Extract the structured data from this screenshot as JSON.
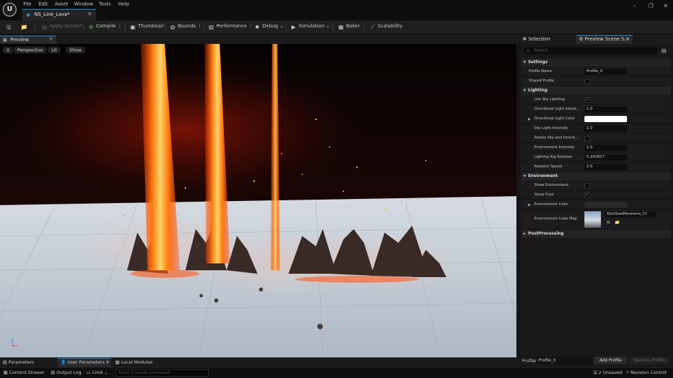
{
  "app": {
    "logo": "U",
    "menu": [
      "File",
      "Edit",
      "Asset",
      "Window",
      "Tools",
      "Help"
    ],
    "tab_title": "NS_Line_Lava*",
    "window_controls": [
      "–",
      "❐",
      "✕"
    ]
  },
  "toolbar": {
    "items": [
      {
        "label": "Apply Scratch",
        "icon": "apply-icon",
        "enabled": false
      },
      {
        "label": "Compile",
        "icon": "compile-icon",
        "enabled": true
      },
      {
        "label": "Thumbnail",
        "icon": "thumbnail-icon",
        "enabled": true
      },
      {
        "label": "Bounds",
        "icon": "bounds-icon",
        "enabled": true
      },
      {
        "label": "Performance",
        "icon": "performance-icon",
        "enabled": true
      },
      {
        "label": "Debug",
        "icon": "debug-icon",
        "enabled": true
      },
      {
        "label": "Simulation",
        "icon": "simulation-icon",
        "enabled": true
      },
      {
        "label": "Baker",
        "icon": "baker-icon",
        "enabled": true
      },
      {
        "label": "Scalability",
        "icon": "scalability-icon",
        "enabled": true
      }
    ]
  },
  "preview": {
    "tab_label": "Preview",
    "view_mode": "Perspective",
    "lit_mode": "Lit",
    "show_label": "Show"
  },
  "right_panel": {
    "tabs": [
      "Selection",
      "Preview Scene S..."
    ],
    "search_placeholder": "Search",
    "sections": {
      "settings": "Settings",
      "lighting": "Lighting",
      "environment": "Environment",
      "postprocessing": "PostProcessing"
    },
    "settings_rows": [
      {
        "label": "Profile Name",
        "value": "Profile_0",
        "kind": "text"
      },
      {
        "label": "Shared Profile",
        "value": "",
        "kind": "checkbox",
        "checked": false
      }
    ],
    "lighting_rows": [
      {
        "label": "Use Sky Lighting",
        "value": "",
        "kind": "checkbox",
        "checked": true
      },
      {
        "label": "Directional Light Intens...",
        "value": "1.0",
        "kind": "text"
      },
      {
        "label": "Directional Light Color",
        "value": "",
        "kind": "color",
        "color": "#ffffff"
      },
      {
        "label": "Sky Light Intensity",
        "value": "1.0",
        "kind": "text"
      },
      {
        "label": "Rotate Sky and Directi...",
        "value": "",
        "kind": "checkbox",
        "checked": false
      },
      {
        "label": "Environment Intensity",
        "value": "1.0",
        "kind": "text"
      },
      {
        "label": "Lighting Rig Rotation",
        "value": "5.291817",
        "kind": "text"
      },
      {
        "label": "Rotation Speed",
        "value": "2.0",
        "kind": "text"
      }
    ],
    "environment_rows": [
      {
        "label": "Show Environment",
        "value": "",
        "kind": "checkbox",
        "checked": false
      },
      {
        "label": "Show Floor",
        "value": "",
        "kind": "checkbox",
        "checked": true
      },
      {
        "label": "Environment Color",
        "value": "",
        "kind": "color",
        "color": "#2a2a2a"
      }
    ],
    "cube_map": {
      "label": "Environment Cube Map",
      "value": "EpicQuadPanorama_CC"
    },
    "profile_bar": {
      "label": "Profile",
      "value": "Profile_0",
      "add": "Add Profile",
      "remove": "Remove Profile"
    }
  },
  "bottom_tabs": [
    "Parameters",
    "User Parameters",
    "Local Modules"
  ],
  "status_bar": {
    "content_drawer": "Content Drawer",
    "output_log": "Output Log",
    "cmd": "Cmd",
    "console_placeholder": "Enter Console Command",
    "unsaved": "2 Unsaved",
    "revision_control": "Revision Control"
  },
  "colors": {
    "accent": "#1d8bd4",
    "lava": "#ff6a10",
    "floor": "#c9d3dc"
  }
}
